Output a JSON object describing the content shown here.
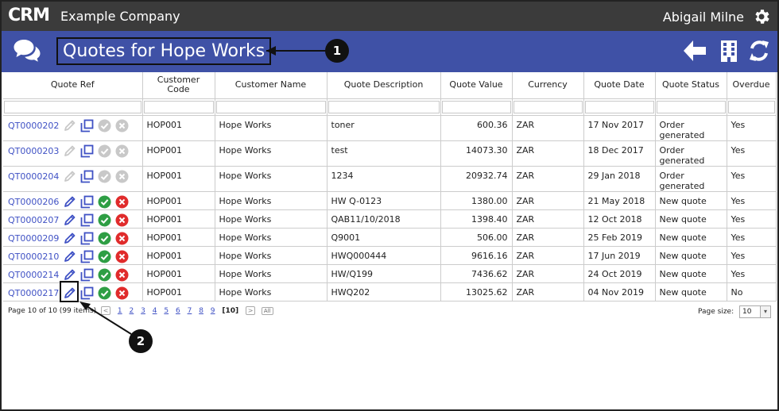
{
  "topbar": {
    "logo": "CRM",
    "company": "Example Company",
    "user": "Abigail Milne",
    "settings_icon": "gear-icon"
  },
  "header": {
    "title": "Quotes for Hope Works",
    "icons": [
      "chat-icon",
      "back-arrow-icon",
      "building-icon",
      "refresh-icon"
    ],
    "background": "#3f51a6"
  },
  "callouts": [
    "1",
    "2"
  ],
  "grid": {
    "columns": [
      "Quote Ref",
      "Customer Code",
      "Customer Name",
      "Quote Description",
      "Quote Value",
      "Currency",
      "Quote Date",
      "Quote Status",
      "Overdue"
    ],
    "rows": [
      {
        "ref": "QT0000202",
        "code": "HOP001",
        "name": "Hope Works",
        "desc": "toner",
        "value": "600.36",
        "currency": "ZAR",
        "date": "17 Nov 2017",
        "status": "Order generated",
        "overdue": "Yes",
        "enabled": false
      },
      {
        "ref": "QT0000203",
        "code": "HOP001",
        "name": "Hope Works",
        "desc": "test",
        "value": "14073.30",
        "currency": "ZAR",
        "date": "18 Dec 2017",
        "status": "Order generated",
        "overdue": "Yes",
        "enabled": false
      },
      {
        "ref": "QT0000204",
        "code": "HOP001",
        "name": "Hope Works",
        "desc": "1234",
        "value": "20932.74",
        "currency": "ZAR",
        "date": "29 Jan 2018",
        "status": "Order generated",
        "overdue": "Yes",
        "enabled": false
      },
      {
        "ref": "QT0000206",
        "code": "HOP001",
        "name": "Hope Works",
        "desc": "HW Q-0123",
        "value": "1380.00",
        "currency": "ZAR",
        "date": "21 May 2018",
        "status": "New quote",
        "overdue": "Yes",
        "enabled": true
      },
      {
        "ref": "QT0000207",
        "code": "HOP001",
        "name": "Hope Works",
        "desc": "QAB11/10/2018",
        "value": "1398.40",
        "currency": "ZAR",
        "date": "12 Oct 2018",
        "status": "New quote",
        "overdue": "Yes",
        "enabled": true
      },
      {
        "ref": "QT0000209",
        "code": "HOP001",
        "name": "Hope Works",
        "desc": "Q9001",
        "value": "506.00",
        "currency": "ZAR",
        "date": "25 Feb 2019",
        "status": "New quote",
        "overdue": "Yes",
        "enabled": true
      },
      {
        "ref": "QT0000210",
        "code": "HOP001",
        "name": "Hope Works",
        "desc": "HWQ000444",
        "value": "9616.16",
        "currency": "ZAR",
        "date": "17 Jun 2019",
        "status": "New quote",
        "overdue": "Yes",
        "enabled": true
      },
      {
        "ref": "QT0000214",
        "code": "HOP001",
        "name": "Hope Works",
        "desc": "HW/Q199",
        "value": "7436.62",
        "currency": "ZAR",
        "date": "24 Oct 2019",
        "status": "New quote",
        "overdue": "Yes",
        "enabled": true
      },
      {
        "ref": "QT0000217",
        "code": "HOP001",
        "name": "Hope Works",
        "desc": "HWQ202",
        "value": "13025.62",
        "currency": "ZAR",
        "date": "04 Nov 2019",
        "status": "New quote",
        "overdue": "No",
        "enabled": true
      }
    ]
  },
  "pager": {
    "summary": "Page 10 of 10 (99 items)",
    "pages": [
      "1",
      "2",
      "3",
      "4",
      "5",
      "6",
      "7",
      "8",
      "9"
    ],
    "current": "[10]",
    "prev": "<",
    "next": ">",
    "all": "All",
    "page_size_label": "Page size:",
    "page_size": "10"
  },
  "colors": {
    "link": "#3f51c4",
    "approve": "#2e9e44",
    "reject": "#e02b2b",
    "disabled": "#c8c8c8",
    "topbar": "#3b3b3b"
  }
}
